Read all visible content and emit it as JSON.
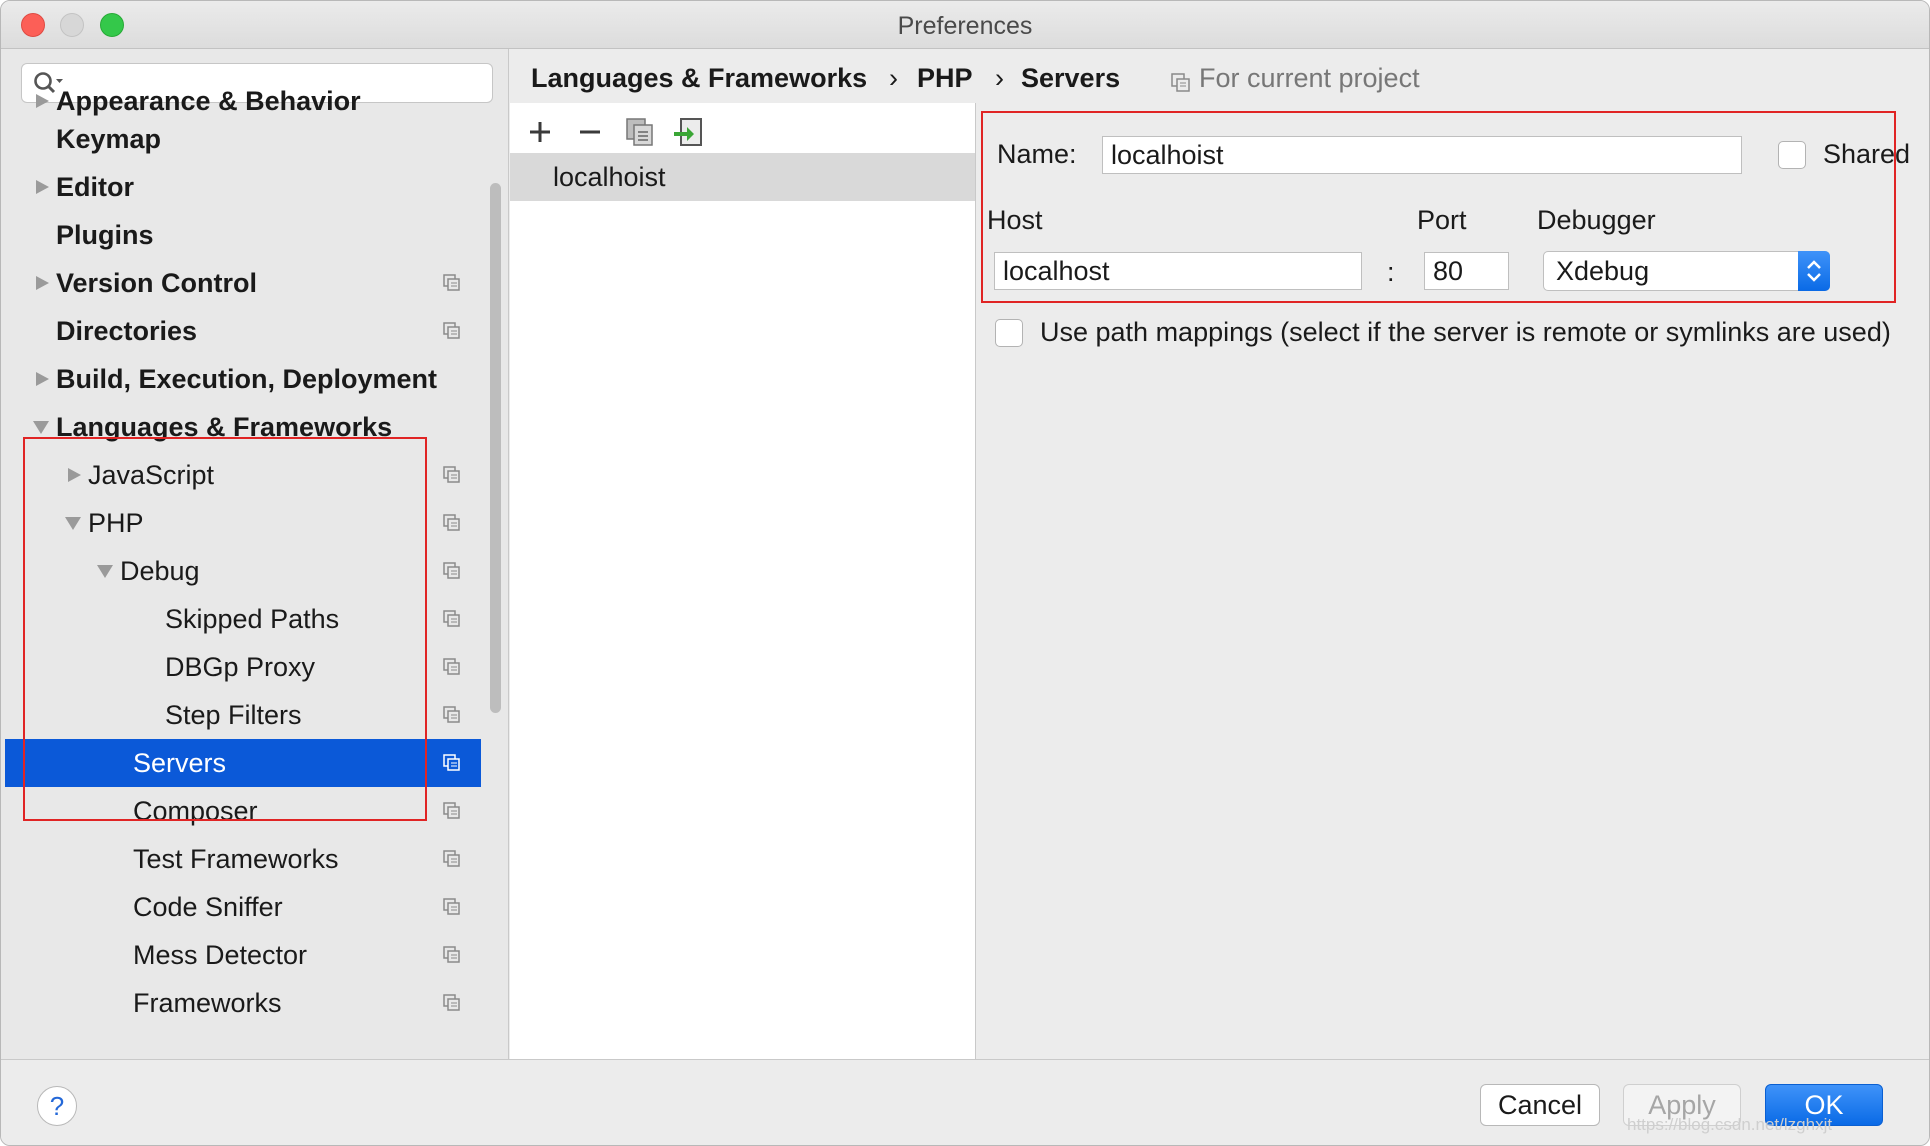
{
  "window": {
    "title": "Preferences"
  },
  "sidebar": {
    "search": {
      "placeholder": ""
    },
    "items": [
      {
        "label": "Appearance & Behavior",
        "name": "sidebar-item-appearance-behavior"
      },
      {
        "label": "Keymap",
        "name": "sidebar-item-keymap"
      },
      {
        "label": "Editor",
        "name": "sidebar-item-editor"
      },
      {
        "label": "Plugins",
        "name": "sidebar-item-plugins"
      },
      {
        "label": "Version Control",
        "name": "sidebar-item-version-control"
      },
      {
        "label": "Directories",
        "name": "sidebar-item-directories"
      },
      {
        "label": "Build, Execution, Deployment",
        "name": "sidebar-item-build-execution-deployment"
      },
      {
        "label": "Languages & Frameworks",
        "name": "sidebar-item-languages-frameworks"
      },
      {
        "label": "JavaScript",
        "name": "sidebar-item-javascript"
      },
      {
        "label": "PHP",
        "name": "sidebar-item-php"
      },
      {
        "label": "Debug",
        "name": "sidebar-item-debug"
      },
      {
        "label": "Skipped Paths",
        "name": "sidebar-item-skipped-paths"
      },
      {
        "label": "DBGp Proxy",
        "name": "sidebar-item-dbgp-proxy"
      },
      {
        "label": "Step Filters",
        "name": "sidebar-item-step-filters"
      },
      {
        "label": "Servers",
        "name": "sidebar-item-servers"
      },
      {
        "label": "Composer",
        "name": "sidebar-item-composer"
      },
      {
        "label": "Test Frameworks",
        "name": "sidebar-item-test-frameworks"
      },
      {
        "label": "Code Sniffer",
        "name": "sidebar-item-code-sniffer"
      },
      {
        "label": "Mess Detector",
        "name": "sidebar-item-mess-detector"
      },
      {
        "label": "Frameworks",
        "name": "sidebar-item-frameworks"
      }
    ]
  },
  "breadcrumb": {
    "items": [
      "Languages & Frameworks",
      "PHP",
      "Servers"
    ],
    "separator": "›",
    "scope": "For current project"
  },
  "servers_list": {
    "items": [
      "localhoist"
    ]
  },
  "server_form": {
    "name_label": "Name:",
    "name_value": "localhoist",
    "shared_label": "Shared",
    "host_label": "Host",
    "host_value": "localhost",
    "colon": ":",
    "port_label": "Port",
    "port_value": "80",
    "debugger_label": "Debugger",
    "debugger_value": "Xdebug",
    "path_mappings_label": "Use path mappings (select if the server is remote or symlinks are used)"
  },
  "footer": {
    "help_label": "?",
    "cancel_label": "Cancel",
    "apply_label": "Apply",
    "ok_label": "OK",
    "watermark": "https://blog.csdn.net/lzghxjt"
  },
  "colors": {
    "selection": "#0b59d8",
    "highlight_box": "#e02424",
    "primary_button": "#0a6ae6"
  }
}
